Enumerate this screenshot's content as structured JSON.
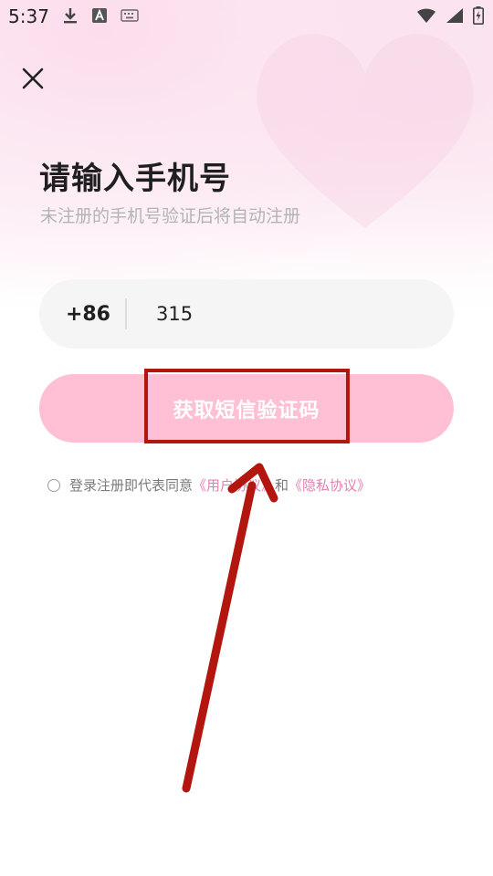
{
  "status_bar": {
    "time": "5:37",
    "icons_left": [
      "download-icon",
      "font-a-icon",
      "keyboard-icon"
    ],
    "icons_right": [
      "wifi-icon",
      "signal-icon",
      "battery-charging-icon"
    ]
  },
  "header": {
    "close_icon": "close-icon"
  },
  "main": {
    "title": "请输入手机号",
    "subtitle": "未注册的手机号验证后将自动注册",
    "phone": {
      "country_code": "+86",
      "value": "315",
      "placeholder": ""
    },
    "get_code_button": "获取短信验证码",
    "agreement": {
      "prefix": "登录注册即代表同意",
      "user_agreement": "《用户协议》",
      "and": "和",
      "privacy_policy": "《隐私协议》"
    }
  },
  "colors": {
    "button_bg": "#ffc0d6",
    "link": "#e57fb1",
    "highlight": "#b3150f",
    "field_bg": "#f5f5f5"
  }
}
